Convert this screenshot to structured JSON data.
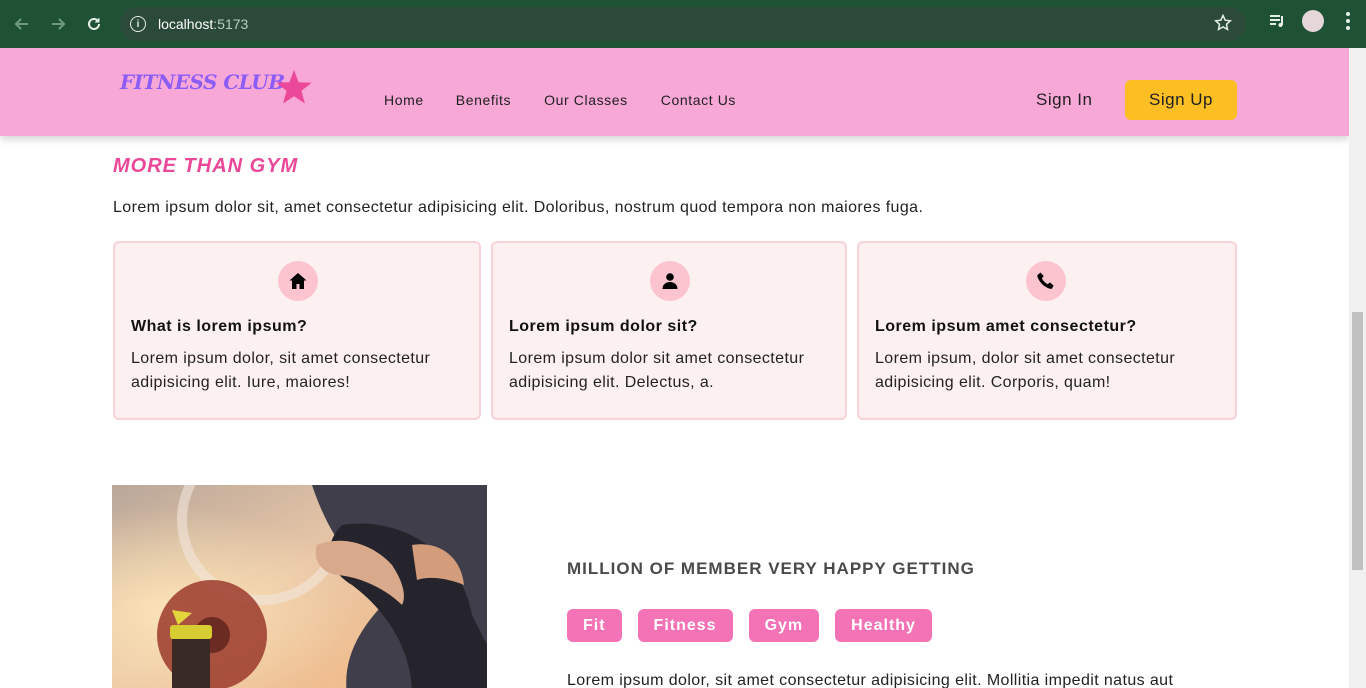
{
  "browser": {
    "url_host": "localhost",
    "url_port": ":5173"
  },
  "header": {
    "logo_text": "FITNESS CLUB",
    "nav": [
      "Home",
      "Benefits",
      "Our Classes",
      "Contact Us"
    ],
    "sign_in": "Sign In",
    "sign_up": "Sign Up",
    "bg_color": "#f8a8d6",
    "accent_color": "#fbbf24"
  },
  "benefits": {
    "title": "MORE THAN GYM",
    "description": "Lorem ipsum dolor sit, amet consectetur adipisicing elit. Doloribus, nostrum quod tempora non maiores fuga.",
    "cards": [
      {
        "icon": "home-icon",
        "title": "What is lorem ipsum?",
        "body": "Lorem ipsum dolor, sit amet consectetur adipisicing elit. Iure, maiores!"
      },
      {
        "icon": "user-icon",
        "title": "Lorem ipsum dolor sit?",
        "body": "Lorem ipsum dolor sit amet consectetur adipisicing elit. Delectus, a."
      },
      {
        "icon": "phone-icon",
        "title": "Lorem ipsum amet consectetur?",
        "body": "Lorem ipsum, dolor sit amet consectetur adipisicing elit. Corporis, quam!"
      }
    ]
  },
  "members": {
    "title": "MILLION OF MEMBER VERY HAPPY GETTING",
    "tags": [
      "Fit",
      "Fitness",
      "Gym",
      "Healthy"
    ],
    "description": "Lorem ipsum dolor, sit amet consectetur adipisicing elit. Mollitia impedit natus aut"
  }
}
